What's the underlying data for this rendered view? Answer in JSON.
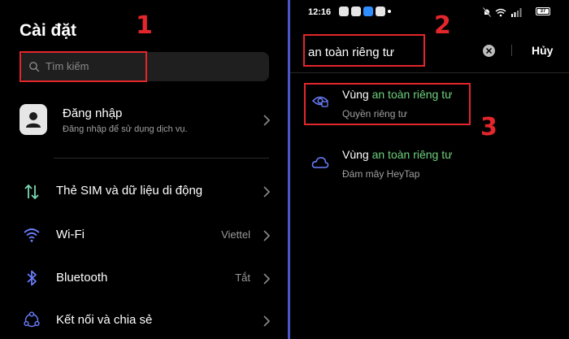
{
  "left": {
    "title": "Cài đặt",
    "search_placeholder": "Tìm kiếm",
    "step_label": "1",
    "login": {
      "title": "Đăng nhập",
      "subtitle": "Đăng nhập để sử dụng dịch vụ."
    },
    "items": [
      {
        "icon": "sim-data-icon",
        "label": "Thẻ SIM và dữ liệu di động",
        "value": ""
      },
      {
        "icon": "wifi-icon",
        "label": "Wi-Fi",
        "value": "Viettel"
      },
      {
        "icon": "bluetooth-icon",
        "label": "Bluetooth",
        "value": "Tắt"
      },
      {
        "icon": "share-connection-icon",
        "label": "Kết nối và chia sẻ",
        "value": ""
      }
    ]
  },
  "right": {
    "status": {
      "time": "12:16",
      "battery": "37"
    },
    "query": "an toàn riêng tư",
    "cancel_label": "Hủy",
    "step2_label": "2",
    "step3_label": "3",
    "results": [
      {
        "icon": "privacy-eye-icon",
        "prefix": "Vùng ",
        "highlight": "an toàn riêng tư",
        "subtitle": "Quyền riêng tư"
      },
      {
        "icon": "cloud-icon",
        "prefix": "Vùng ",
        "highlight": "an toàn riêng tư",
        "subtitle": "Đám mây HeyTap"
      }
    ]
  },
  "colors": {
    "annotation_red": "#e3262c",
    "highlight_green": "#6ed07d",
    "divider_blue": "#4a57c9",
    "icon_blue": "#6b7fff"
  }
}
